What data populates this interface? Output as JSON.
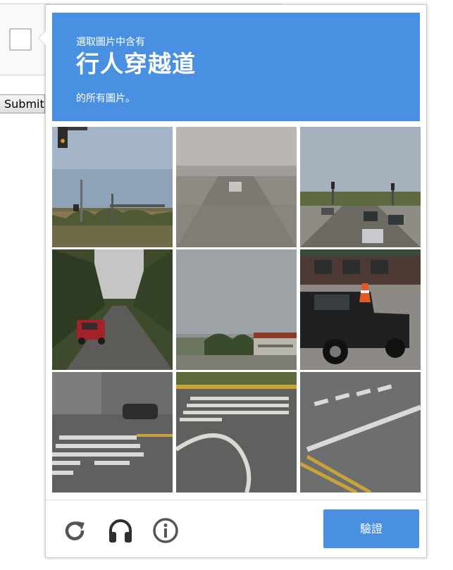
{
  "page": {
    "submit_label": "Submit"
  },
  "challenge": {
    "prompt_line1": "選取圖片中含有",
    "prompt_keyword": "行人穿越道",
    "prompt_line3": "的所有圖片。",
    "verify_label": "驗證",
    "colors": {
      "accent": "#4a90e2",
      "icon": "#555555"
    },
    "tiles": [
      {
        "row": 1,
        "col": 1,
        "scene": "traffic light, signpost and trees under sky"
      },
      {
        "row": 1,
        "col": 2,
        "scene": "empty road with distant car"
      },
      {
        "row": 1,
        "col": 3,
        "scene": "multi-lane road with traffic lights and cars"
      },
      {
        "row": 2,
        "col": 1,
        "scene": "tree-lined road with red car"
      },
      {
        "row": 2,
        "col": 2,
        "scene": "cloudy sky over building and trees"
      },
      {
        "row": 2,
        "col": 3,
        "scene": "black pickup truck with traffic cone"
      },
      {
        "row": 3,
        "col": 1,
        "scene": "crosswalk stripes in parking lot"
      },
      {
        "row": 3,
        "col": 2,
        "scene": "crosswalk stripes with curved lane line"
      },
      {
        "row": 3,
        "col": 3,
        "scene": "crosswalk stripes with yellow lines"
      }
    ],
    "icons": {
      "reload": "reload-icon",
      "audio": "headphones-icon",
      "info": "info-icon"
    }
  }
}
